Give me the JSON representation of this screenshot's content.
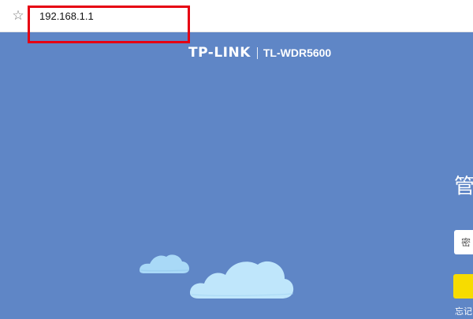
{
  "browser": {
    "url": "192.168.1.1",
    "bookmark_icon": "star-icon",
    "annotation_color": "#e60012"
  },
  "router_page": {
    "background_color": "#5f86c6",
    "brand": {
      "logo_text": "TP-LINK",
      "separator": "|",
      "model": "TL-WDR5600"
    },
    "login": {
      "title": "管",
      "password_placeholder": "密",
      "login_button_label": "",
      "login_button_color": "#f7dc00",
      "forgot_link": "忘记"
    },
    "decorations": {
      "clouds": [
        {
          "name": "small-cloud",
          "color": "#a9d9f7"
        },
        {
          "name": "large-cloud",
          "color": "#bfe6fb"
        }
      ]
    }
  }
}
